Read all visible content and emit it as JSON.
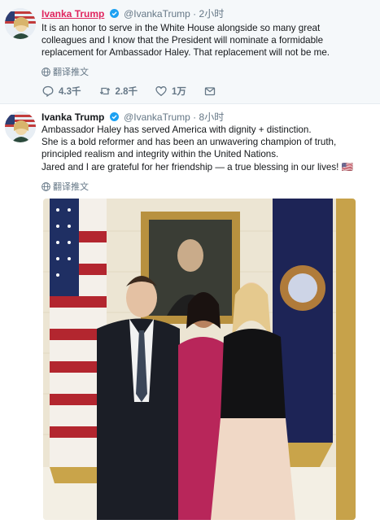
{
  "tweets": [
    {
      "name": "Ivanka Trump",
      "handle": "@IvankaTrump",
      "separator": "·",
      "time": "2小时",
      "text": "It is an honor to serve in the White House alongside so many great\ncolleagues and I know that the President will nominate a formidable\nreplacement for Ambassador Haley. That replacement will not be me.",
      "translate_label": "翻译推文",
      "reply_count": "4.3千",
      "retweet_count": "2.8千",
      "like_count": "1万"
    },
    {
      "name": "Ivanka Trump",
      "handle": "@IvankaTrump",
      "separator": "·",
      "time": "8小时",
      "text": "Ambassador Haley has served America with dignity + distinction.\nShe is a bold reformer and has been an unwavering champion of truth,\nprincipled realism and integrity within the United Nations.\nJared and I are grateful for her friendship — a true blessing in our lives! 🇺🇸",
      "translate_label": "翻译推文"
    }
  ],
  "colors": {
    "name_link": "#e0245e",
    "verified": "#1da1f2",
    "muted": "#657786",
    "text": "#14171a"
  },
  "icons": [
    "verified-badge-icon",
    "globe-icon",
    "reply-icon",
    "retweet-icon",
    "like-icon",
    "message-icon"
  ]
}
